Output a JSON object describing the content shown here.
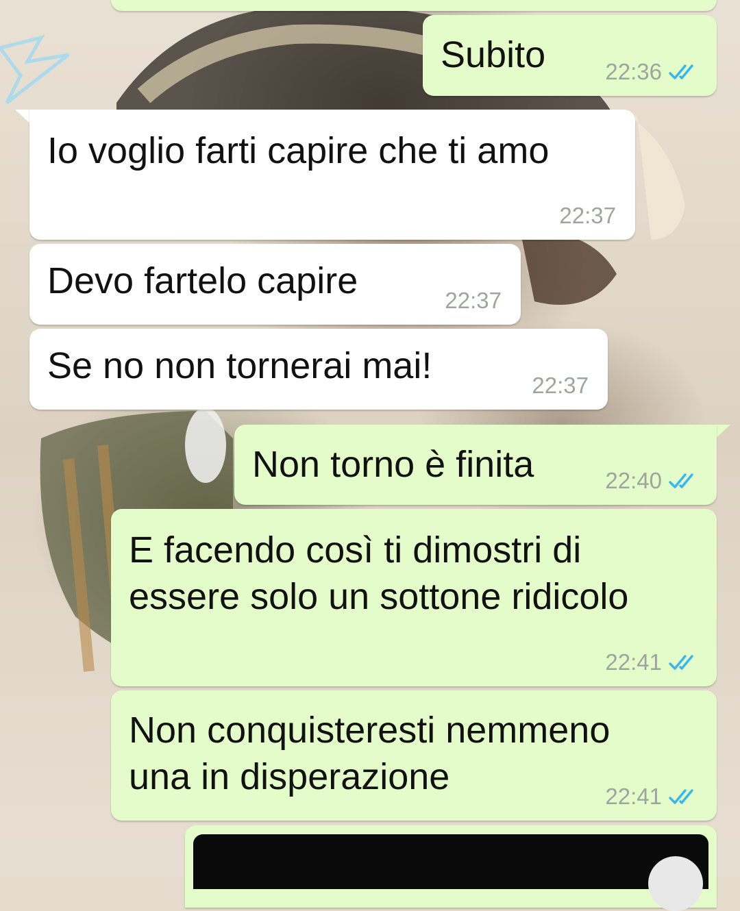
{
  "messages": [
    {
      "text": "",
      "time": ""
    },
    {
      "text": "Subito",
      "time": "22:36"
    },
    {
      "text": "Io voglio farti capire che ti amo",
      "time": "22:37"
    },
    {
      "text": "Devo fartelo capire",
      "time": "22:37"
    },
    {
      "text": "Se no non tornerai mai!",
      "time": "22:37"
    },
    {
      "text": "Non torno è finita",
      "time": "22:40"
    },
    {
      "text": "E facendo così ti dimostri di\nessere solo un sottone ridicolo",
      "time": "22:41"
    },
    {
      "text": "Non conquisteresti nemmeno\nuna in disperazione",
      "time": "22:41"
    }
  ],
  "icons": {
    "read_receipt": "double-check-icon"
  },
  "colors": {
    "outgoing_bubble": "#e3fcc9",
    "incoming_bubble": "#ffffff",
    "read_ticks": "#34b7f1",
    "timestamp": "#9ea49e"
  }
}
